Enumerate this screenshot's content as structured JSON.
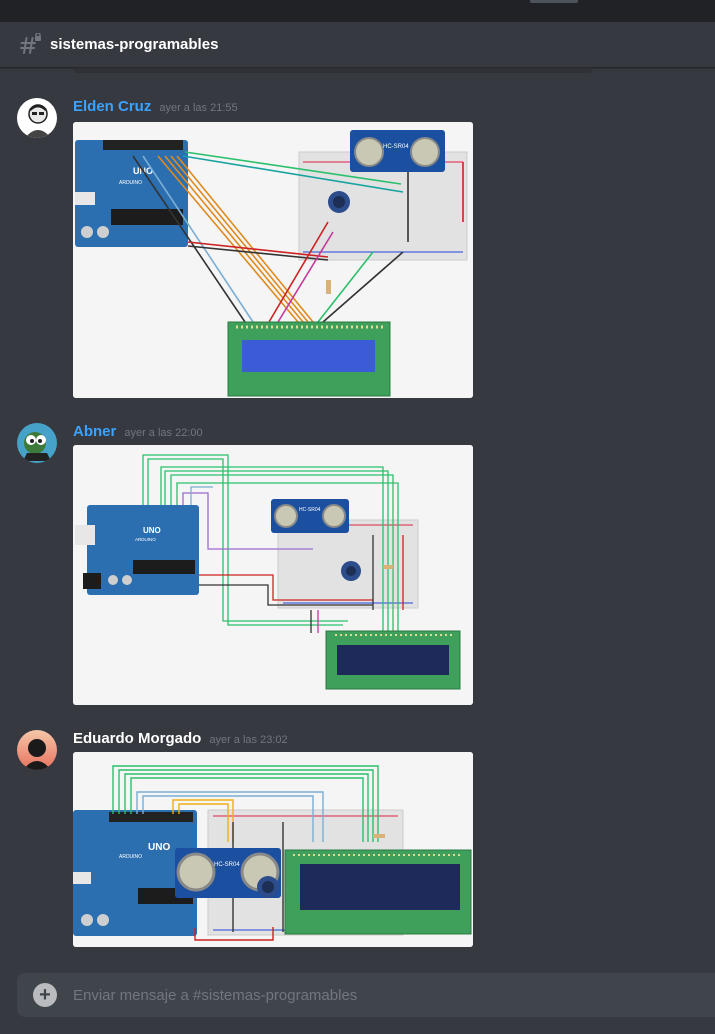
{
  "channel": {
    "name": "sistemas-programables"
  },
  "messages": [
    {
      "username": "Elden Cruz",
      "timestamp": "ayer a las 21:55",
      "name_color": "#3ba2ff"
    },
    {
      "username": "Abner",
      "timestamp": "ayer a las 22:00",
      "name_color": "#3ba2ff"
    },
    {
      "username": "Eduardo Morgado",
      "timestamp": "ayer a las 23:02",
      "name_color": "#ffffff"
    }
  ],
  "composer": {
    "placeholder": "Enviar mensaje a #sistemas-programables"
  },
  "circuit_labels": {
    "board": "UNO",
    "brand": "ARDUINO",
    "sensor": "HC-SR04"
  },
  "colors": {
    "background": "#36393f",
    "header": "#202225",
    "arduino": "#2c6fb0",
    "lcd_pcb": "#3ea05a",
    "lcd_screen": "#3c5bd6"
  }
}
